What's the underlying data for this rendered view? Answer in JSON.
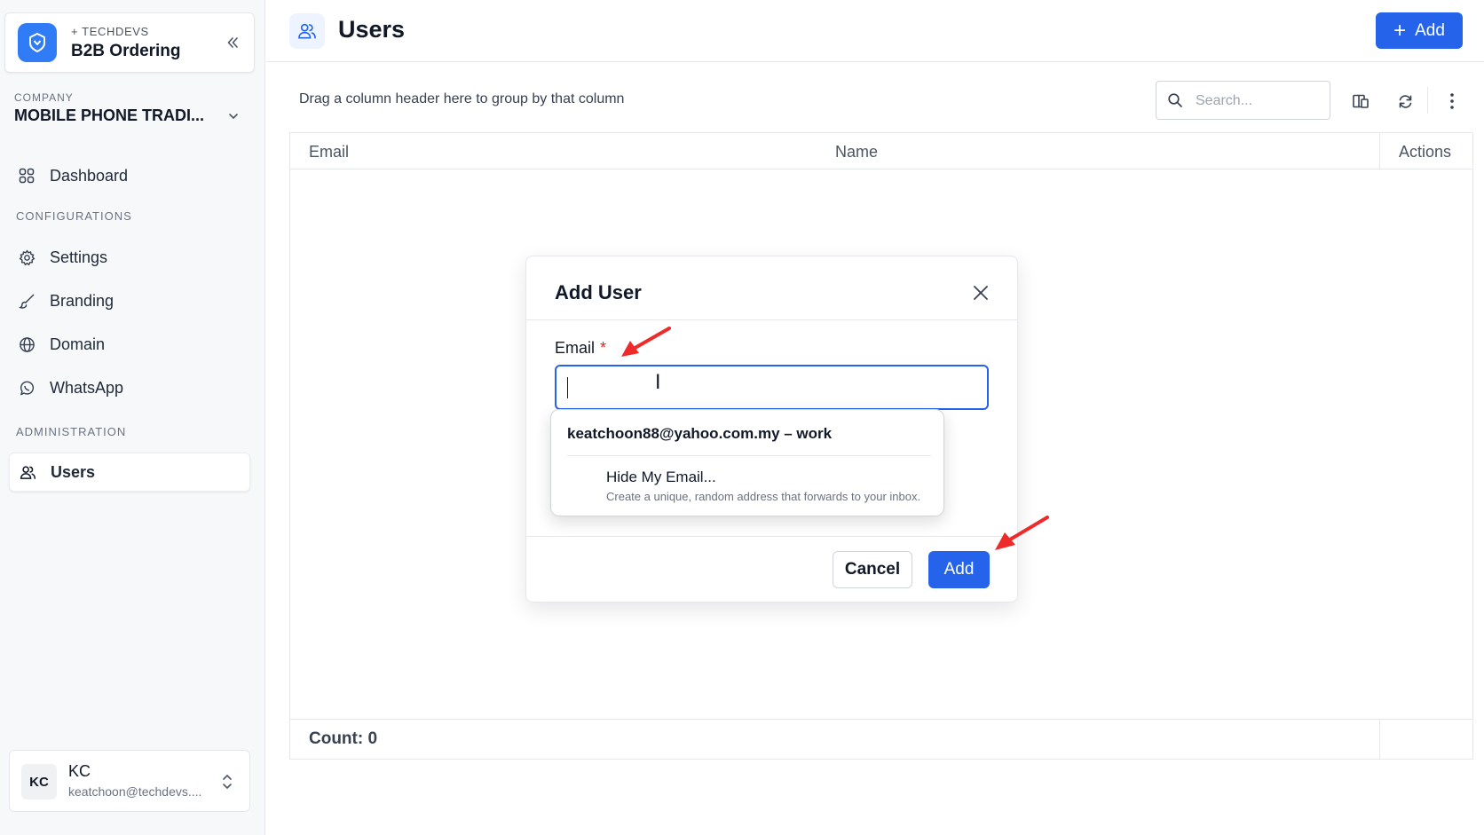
{
  "sidebar": {
    "brand_small": "+ TECHDEVS",
    "brand_title": "B2B Ordering",
    "company_label": "COMPANY",
    "company_name": "MOBILE PHONE TRADI...",
    "dashboard_label": "Dashboard",
    "section_config": "CONFIGURATIONS",
    "section_admin": "ADMINISTRATION",
    "items": [
      {
        "label": "Settings",
        "icon": "gear-icon"
      },
      {
        "label": "Branding",
        "icon": "brush-icon"
      },
      {
        "label": "Domain",
        "icon": "globe-icon"
      },
      {
        "label": "WhatsApp",
        "icon": "whatsapp-icon"
      },
      {
        "label": "Users",
        "icon": "users-icon",
        "active": true
      }
    ],
    "user": {
      "initials": "KC",
      "name": "KC",
      "email": "keatchoon@techdevs...."
    }
  },
  "header": {
    "title": "Users",
    "add_label": "Add"
  },
  "toolbar": {
    "group_hint": "Drag a column header here to group by that column",
    "search_placeholder": "Search..."
  },
  "grid": {
    "columns": [
      "Email",
      "Name",
      "Actions"
    ],
    "count_text": "Count: 0"
  },
  "modal": {
    "title": "Add User",
    "email_label": "Email",
    "required_mark": "*",
    "email_value": "",
    "cancel_label": "Cancel",
    "add_label": "Add"
  },
  "autofill": {
    "suggestion": "keatchoon88@yahoo.com.my – work",
    "hide_title": "Hide My Email...",
    "hide_sub": "Create a unique, random address that forwards to your inbox."
  },
  "colors": {
    "accent": "#2563eb",
    "annotation_arrow": "#ef2a2a"
  }
}
